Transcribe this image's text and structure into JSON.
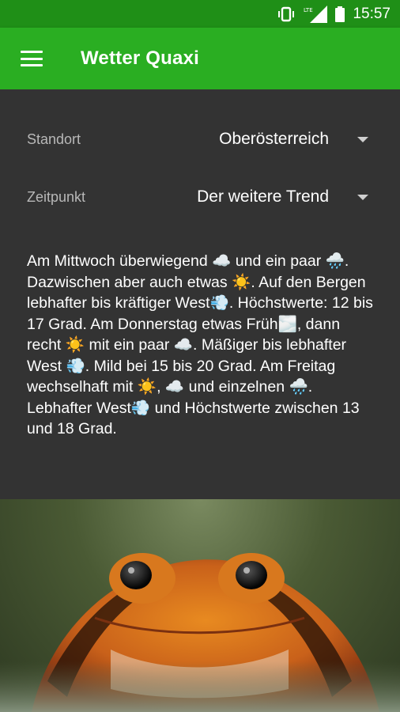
{
  "status_bar": {
    "time": "15:57",
    "icons": [
      "vibrate-icon",
      "lte-icon",
      "signal-icon",
      "battery-icon"
    ],
    "lte_label": "LTE"
  },
  "app_bar": {
    "title": "Wetter Quaxi",
    "color": "#2aae22"
  },
  "filters": {
    "location": {
      "label": "Standort",
      "value": "Oberösterreich"
    },
    "time": {
      "label": "Zeitpunkt",
      "value": "Der weitere Trend"
    }
  },
  "forecast": {
    "text": "Am Mittwoch überwiegend ☁️ und ein paar 🌧️. Dazwischen aber auch etwas ☀️. Auf den Bergen lebhafter bis kräftiger West💨. Höchstwerte: 12 bis 17 Grad. Am Donnerstag etwas Früh🌫️, dann recht ☀️ mit ein paar ☁️. Mäßiger bis lebhafter West 💨. Mild bei 15 bis 20 Grad. Am Freitag wechselhaft mit ☀️, ☁️ und einzelnen 🌧️. Lebhafter West💨 und Höchstwerte zwischen 13 und 18 Grad."
  },
  "image": {
    "subject": "tomato-frog"
  }
}
